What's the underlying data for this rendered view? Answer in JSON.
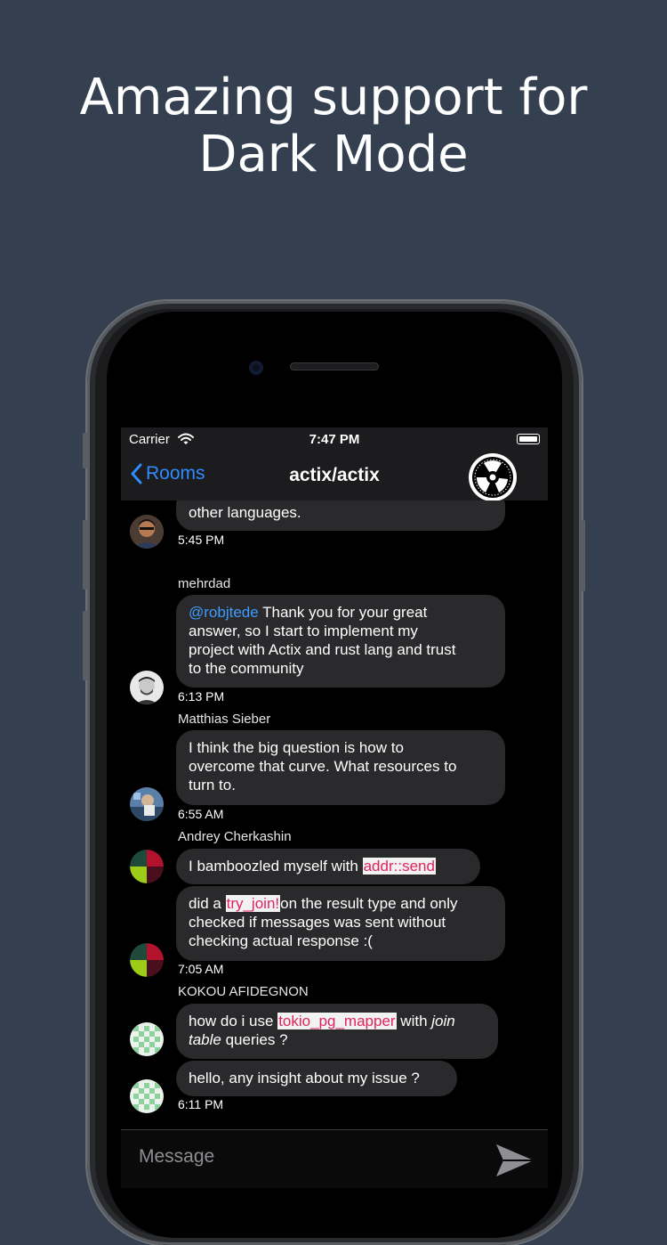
{
  "headline": {
    "line1": "Amazing support for",
    "line2": "Dark Mode"
  },
  "status": {
    "carrier": "Carrier",
    "time": "7:47 PM"
  },
  "nav": {
    "back_label": "Rooms",
    "title": "actix/actix"
  },
  "messages": {
    "m0": {
      "text": "other languages.",
      "time": "5:45 PM"
    },
    "m1": {
      "sender": "mehrdad",
      "mention": "@robjtede",
      "text_l1": " Thank you for your great",
      "text_l2": "answer, so I start to implement my",
      "text_l3": "project with Actix and rust lang and trust",
      "text_l4": "to the community",
      "time": "6:13 PM"
    },
    "m2": {
      "sender": "Matthias Sieber",
      "text_l1": "I think the big question is how to",
      "text_l2": "overcome that curve. What resources to",
      "text_l3": "turn to.",
      "time": "6:55 AM"
    },
    "m3": {
      "sender": "Andrey Cherkashin",
      "a_text": "I bamboozled myself with ",
      "a_code": "addr::send",
      "b_pre": "did a ",
      "b_code": "try_join!",
      "b_post": "on the result type and only",
      "b_l2": "checked if messages was sent without",
      "b_l3": "checking actual response :(",
      "time": "7:05 AM"
    },
    "m4": {
      "sender": "KOKOU AFIDEGNON",
      "a_pre": "how do i use ",
      "a_code": "tokio_pg_mapper",
      "a_post": " with ",
      "a_italic1": "join",
      "a_italic2": "table",
      "a_end": "  queries ?",
      "b_text": "hello, any insight about my issue ?",
      "time": "6:11 PM"
    }
  },
  "input": {
    "placeholder": "Message"
  },
  "colors": {
    "background": "#344050",
    "accent": "#2f8cff",
    "bubble": "#2a2a2c",
    "code": "#e0245e"
  }
}
